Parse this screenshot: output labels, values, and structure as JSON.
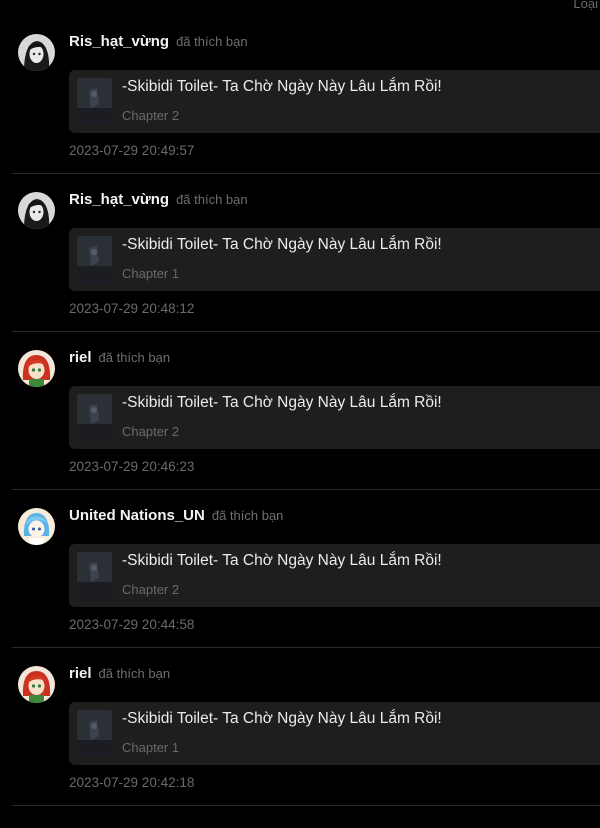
{
  "header": {
    "top_right_label": "Loại"
  },
  "notifications": [
    {
      "username": "Ris_hạt_vừng",
      "action": "đã thích bạn",
      "avatar_icon": "bw-portrait-avatar",
      "story_title": "-Skibidi Toilet- Ta Chờ Ngày Này Lâu Lắm Rồi!",
      "chapter": "Chapter 2",
      "timestamp": "2023-07-29 20:49:57"
    },
    {
      "username": "Ris_hạt_vừng",
      "action": "đã thích bạn",
      "avatar_icon": "bw-portrait-avatar",
      "story_title": "-Skibidi Toilet- Ta Chờ Ngày Này Lâu Lắm Rồi!",
      "chapter": "Chapter 1",
      "timestamp": "2023-07-29 20:48:12"
    },
    {
      "username": "riel",
      "action": "đã thích bạn",
      "avatar_icon": "red-hair-anime-avatar",
      "story_title": "-Skibidi Toilet- Ta Chờ Ngày Này Lâu Lắm Rồi!",
      "chapter": "Chapter 2",
      "timestamp": "2023-07-29 20:46:23"
    },
    {
      "username": "United Nations_UN",
      "action": "đã thích bạn",
      "avatar_icon": "blue-anime-avatar",
      "story_title": "-Skibidi Toilet- Ta Chờ Ngày Này Lâu Lắm Rồi!",
      "chapter": "Chapter 2",
      "timestamp": "2023-07-29 20:44:58"
    },
    {
      "username": "riel",
      "action": "đã thích bạn",
      "avatar_icon": "red-hair-anime-avatar",
      "story_title": "-Skibidi Toilet- Ta Chờ Ngày Này Lâu Lắm Rồi!",
      "chapter": "Chapter 1",
      "timestamp": "2023-07-29 20:42:18"
    }
  ],
  "colors": {
    "background": "#000000",
    "card": "#1e1e1e",
    "username": "#f2f2f2",
    "muted": "#6a6a6a"
  }
}
